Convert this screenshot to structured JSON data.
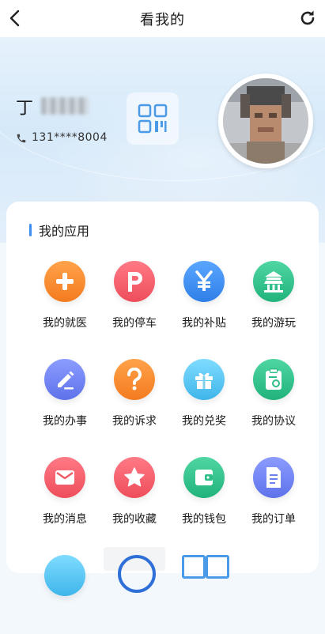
{
  "nav": {
    "title": "看我的"
  },
  "user": {
    "name": "丁",
    "phone": "131****8004"
  },
  "section": {
    "title": "我的应用"
  },
  "apps": [
    {
      "label": "我的就医",
      "icon": "plus-icon",
      "color": "#f6892a"
    },
    {
      "label": "我的停车",
      "icon": "parking-icon",
      "color": "#f05b67"
    },
    {
      "label": "我的补贴",
      "icon": "yen-icon",
      "color": "#3d8ef0"
    },
    {
      "label": "我的游玩",
      "icon": "temple-icon",
      "color": "#2fbf8a"
    },
    {
      "label": "我的办事",
      "icon": "pen-icon",
      "color": "#6f84f0"
    },
    {
      "label": "我的诉求",
      "icon": "question-icon",
      "color": "#f6892a"
    },
    {
      "label": "我的兑奖",
      "icon": "gift-icon",
      "color": "#56c7f0"
    },
    {
      "label": "我的协议",
      "icon": "clipboard-icon",
      "color": "#2fbf8a"
    },
    {
      "label": "我的消息",
      "icon": "mail-icon",
      "color": "#f05b67"
    },
    {
      "label": "我的收藏",
      "icon": "star-icon",
      "color": "#f05b67"
    },
    {
      "label": "我的钱包",
      "icon": "wallet-icon",
      "color": "#2fbf8a"
    },
    {
      "label": "我的订单",
      "icon": "document-icon",
      "color": "#6f84f0"
    }
  ]
}
